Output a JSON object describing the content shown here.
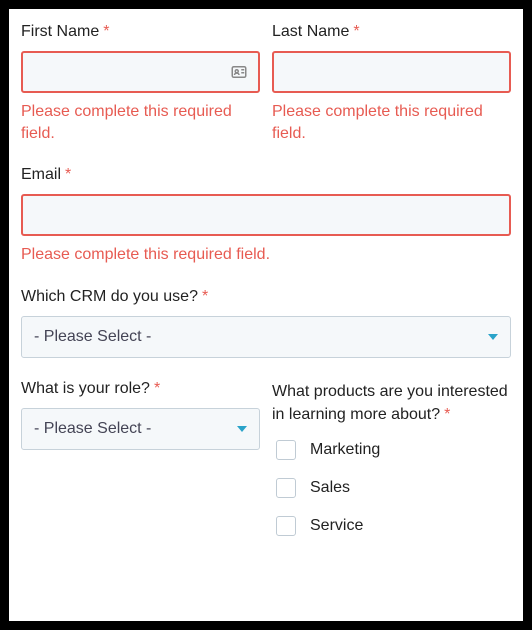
{
  "firstName": {
    "label": "First Name",
    "required": "*",
    "value": "",
    "error": "Please complete this required field."
  },
  "lastName": {
    "label": "Last Name",
    "required": "*",
    "value": "",
    "error": "Please complete this required field."
  },
  "email": {
    "label": "Email",
    "required": "*",
    "value": "",
    "error": "Please complete this required field."
  },
  "crm": {
    "label": "Which CRM do you use?",
    "required": "*",
    "selected": "- Please Select -"
  },
  "role": {
    "label": "What is your role?",
    "required": "*",
    "selected": "- Please Select -"
  },
  "products": {
    "label": "What products are you interested in learning more about?",
    "required": "*",
    "options": [
      "Marketing",
      "Sales",
      "Service"
    ]
  }
}
